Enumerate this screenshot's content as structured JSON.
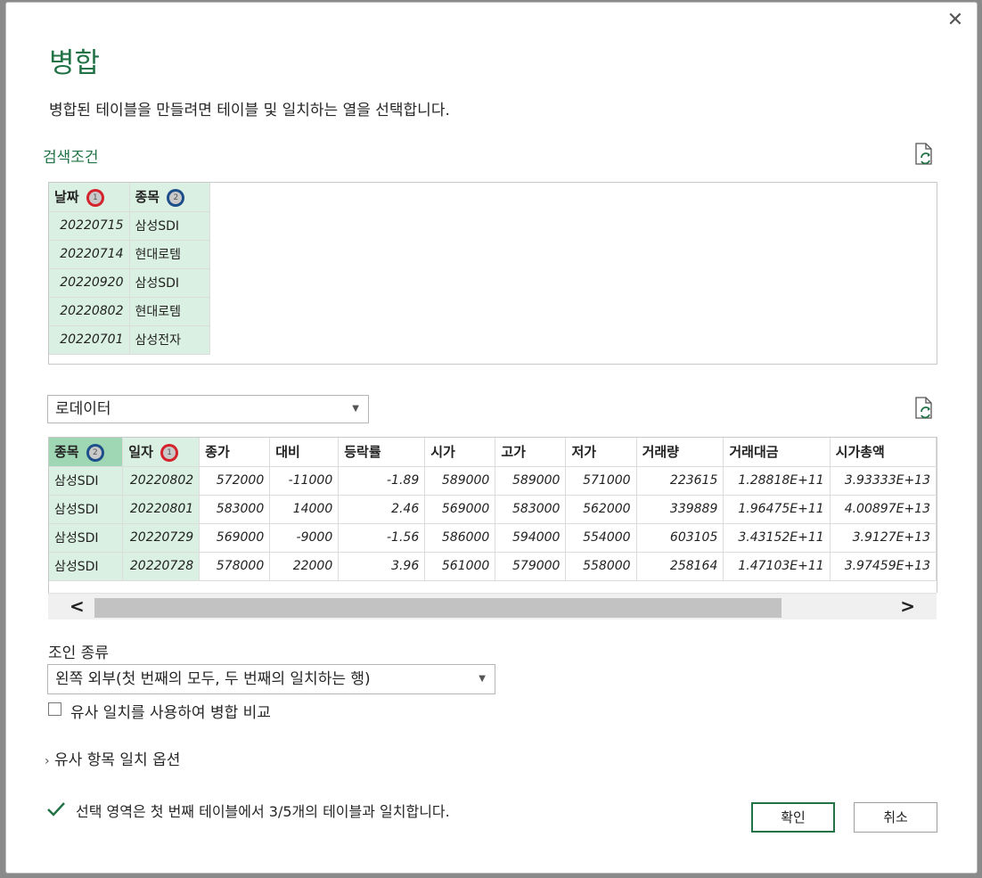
{
  "dialog": {
    "title": "병합",
    "description": "병합된 테이블을 만들려면 테이블 및 일치하는 열을 선택합니다.",
    "close_glyph": "✕"
  },
  "first_table": {
    "name": "검색조건",
    "columns": [
      {
        "label": "날짜",
        "badge": "1"
      },
      {
        "label": "종목",
        "badge": "2"
      }
    ],
    "rows": [
      [
        "20220715",
        "삼성SDI"
      ],
      [
        "20220714",
        "현대로템"
      ],
      [
        "20220920",
        "삼성SDI"
      ],
      [
        "20220802",
        "현대로템"
      ],
      [
        "20220701",
        "삼성전자"
      ]
    ]
  },
  "second_table": {
    "selected": "로데이터",
    "columns": [
      {
        "label": "종목",
        "badge": "2"
      },
      {
        "label": "일자",
        "badge": "1"
      },
      {
        "label": "종가"
      },
      {
        "label": "대비"
      },
      {
        "label": "등락률"
      },
      {
        "label": "시가"
      },
      {
        "label": "고가"
      },
      {
        "label": "저가"
      },
      {
        "label": "거래량"
      },
      {
        "label": "거래대금"
      },
      {
        "label": "시가총액"
      }
    ],
    "rows": [
      [
        "삼성SDI",
        "20220802",
        "572000",
        "-11000",
        "-1.89",
        "589000",
        "589000",
        "571000",
        "223615",
        "1.28818E+11",
        "3.93333E+13"
      ],
      [
        "삼성SDI",
        "20220801",
        "583000",
        "14000",
        "2.46",
        "569000",
        "583000",
        "562000",
        "339889",
        "1.96475E+11",
        "4.00897E+13"
      ],
      [
        "삼성SDI",
        "20220729",
        "569000",
        "-9000",
        "-1.56",
        "586000",
        "594000",
        "554000",
        "603105",
        "3.43152E+11",
        "3.9127E+13"
      ],
      [
        "삼성SDI",
        "20220728",
        "578000",
        "22000",
        "3.96",
        "561000",
        "579000",
        "558000",
        "258164",
        "1.47103E+11",
        "3.97459E+13"
      ]
    ]
  },
  "join": {
    "label": "조인 종류",
    "selected": "왼쪽 외부(첫 번째의 모두, 두 번째의 일치하는 행)"
  },
  "fuzzy": {
    "checkbox_label": "유사 일치를 사용하여 병합 비교",
    "options_label": "유사 항목 일치 옵션"
  },
  "status": "선택 영역은 첫 번째 테이블에서 3/5개의 테이블과 일치합니다.",
  "buttons": {
    "ok": "확인",
    "cancel": "취소"
  },
  "colors": {
    "accent": "#217346",
    "selected_column": "#daf0e2",
    "selected_header": "#9fd6b3",
    "annotation_red": "#d4232c",
    "annotation_blue": "#1c4f8a"
  }
}
